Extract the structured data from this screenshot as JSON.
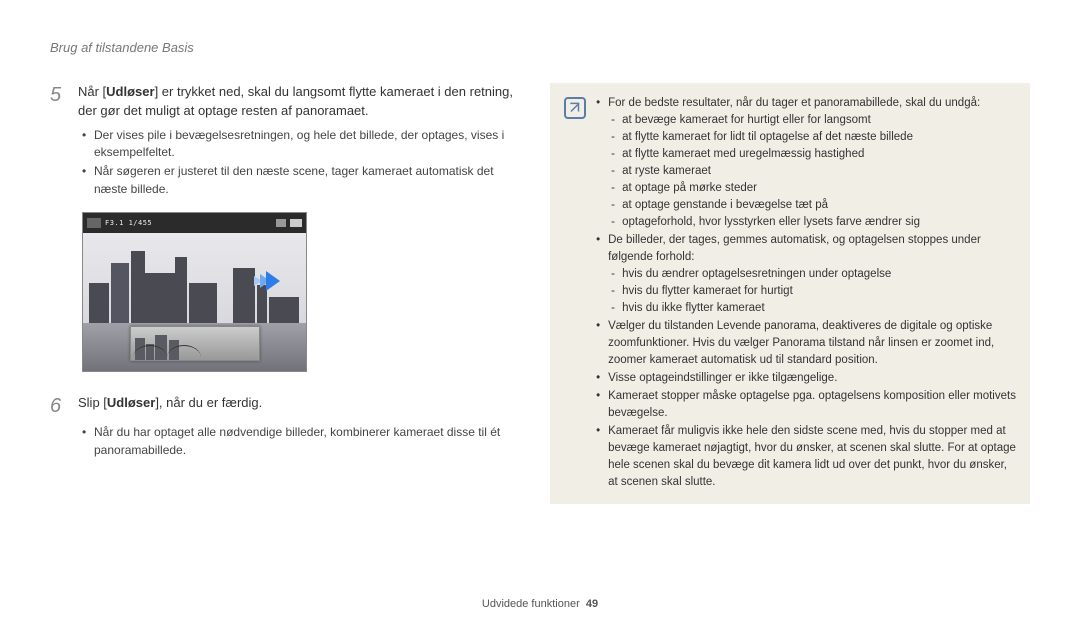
{
  "header": "Brug af tilstandene Basis",
  "camera": {
    "exposure": "F3.1 1/455"
  },
  "step5": {
    "num": "5",
    "prefix": "Når [",
    "bold": "Udløser",
    "suffix": "] er trykket ned, skal du langsomt flytte kameraet i den retning, der gør det muligt at optage resten af panoramaet.",
    "b1": "Der vises pile i bevægelsesretningen, og hele det billede, der optages, vises i eksempelfeltet.",
    "b2": "Når søgeren er justeret til den næste scene, tager kameraet automatisk det næste billede."
  },
  "step6": {
    "num": "6",
    "prefix": "Slip [",
    "bold": "Udløser",
    "suffix": "], når du er færdig.",
    "b1": "Når du har optaget alle nødvendige billeder, kombinerer kameraet disse til ét panoramabillede."
  },
  "tip": {
    "l1": "For de bedste resultater, når du tager et panoramabillede, skal du undgå:",
    "l1a": "at bevæge kameraet for hurtigt eller for langsomt",
    "l1b": "at flytte kameraet for lidt til optagelse af det næste billede",
    "l1c": "at flytte kameraet med uregelmæssig hastighed",
    "l1d": "at ryste kameraet",
    "l1e": "at optage på mørke steder",
    "l1f": "at optage genstande i bevægelse tæt på",
    "l1g": "optageforhold, hvor lysstyrken eller lysets farve ændrer sig",
    "l2": "De billeder, der tages, gemmes automatisk, og optagelsen stoppes under følgende forhold:",
    "l2a": "hvis du ændrer optagelsesretningen under optagelse",
    "l2b": "hvis du flytter kameraet for hurtigt",
    "l2c": "hvis du ikke flytter kameraet",
    "l3": "Vælger du tilstanden Levende panorama, deaktiveres de digitale og optiske zoomfunktioner. Hvis du vælger Panorama tilstand når linsen er zoomet ind, zoomer kameraet automatisk ud til standard position.",
    "l4": "Visse optageindstillinger er ikke tilgængelige.",
    "l5": "Kameraet stopper måske optagelse pga. optagelsens komposition eller motivets bevægelse.",
    "l6": "Kameraet får muligvis ikke hele den sidste scene med, hvis du stopper med at bevæge kameraet nøjagtigt, hvor du ønsker, at scenen skal slutte. For at optage hele scenen skal du bevæge dit kamera lidt ud over det punkt, hvor du ønsker, at scenen skal slutte."
  },
  "footer": {
    "section": "Udvidede funktioner",
    "page": "49"
  }
}
